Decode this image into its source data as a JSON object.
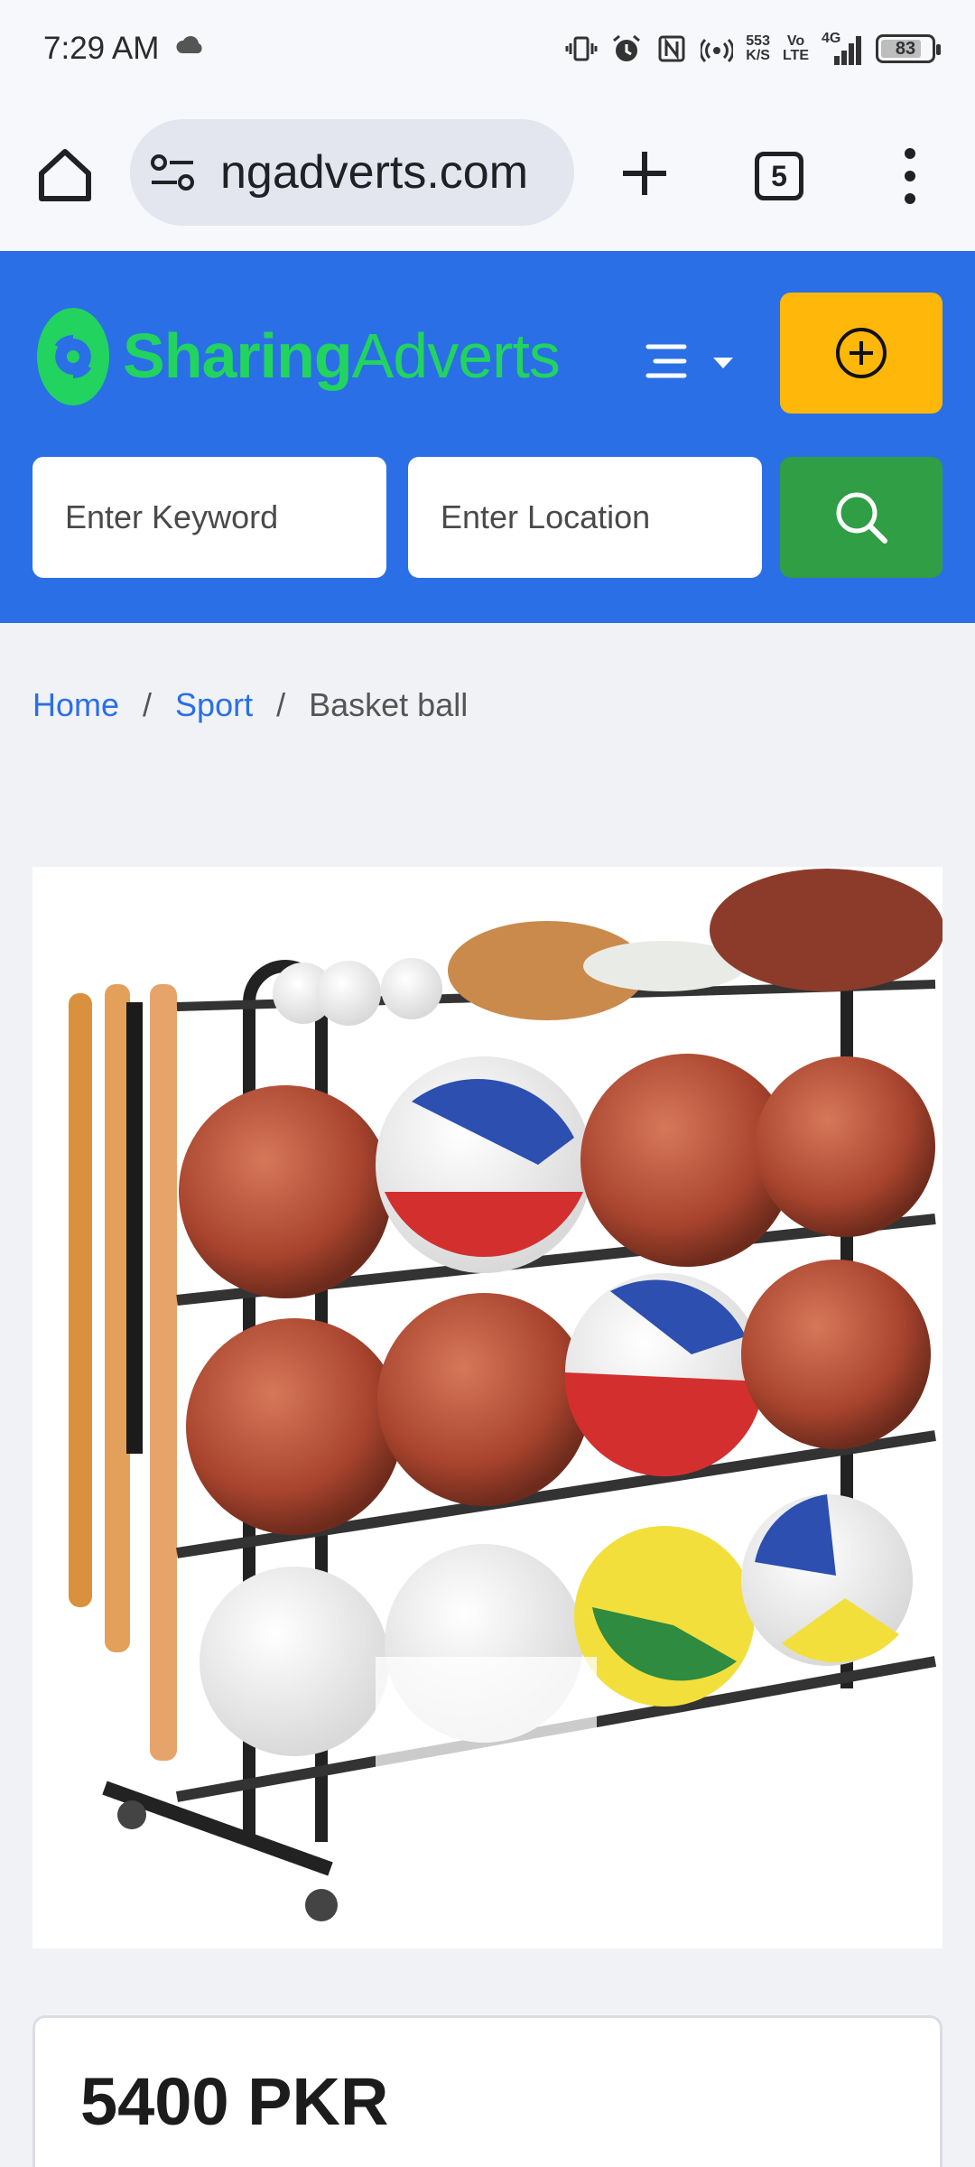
{
  "status_bar": {
    "time": "7:29 AM",
    "net_speed_value": "553",
    "net_speed_unit": "K/S",
    "volte_top": "Vo",
    "volte_bottom": "LTE",
    "network": "4G",
    "battery": "83"
  },
  "browser": {
    "url": "ngadverts.com",
    "tab_count": "5",
    "icons": [
      "home-icon",
      "site-settings-icon",
      "new-tab-icon",
      "tabs-icon",
      "more-menu-icon"
    ]
  },
  "header": {
    "logo_part1": "Sharing",
    "logo_part2": "Adverts",
    "brand_color": "#2a6fe6",
    "post_button_color": "#ffb70a",
    "search_button_color": "#2f9e44",
    "keyword_placeholder": "Enter Keyword",
    "location_placeholder": "Enter Location"
  },
  "breadcrumb": {
    "items": [
      "Home",
      "Sport"
    ],
    "separator": "/",
    "current": "Basket ball"
  },
  "listing": {
    "price": "5400 PKR"
  }
}
